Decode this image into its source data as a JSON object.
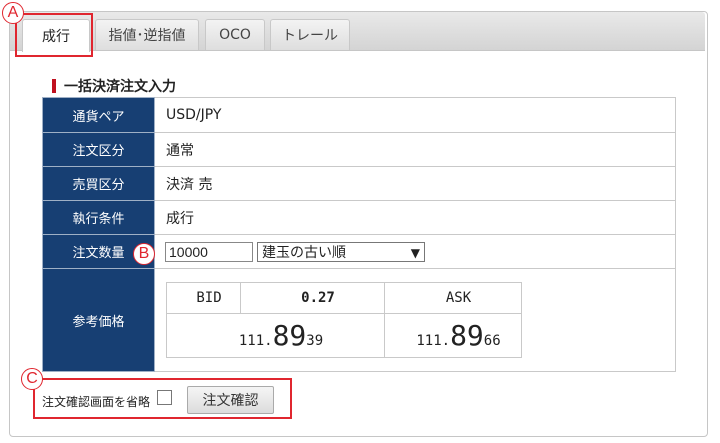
{
  "tabs": [
    {
      "label": "成行"
    },
    {
      "label": "指値･逆指値"
    },
    {
      "label": "OCO"
    },
    {
      "label": "トレール"
    }
  ],
  "section_title": "一括決済注文入力",
  "form": {
    "currency_pair": {
      "label": "通貨ペア",
      "value": "USD/JPY"
    },
    "order_type": {
      "label": "注文区分",
      "value": "通常"
    },
    "trade_type": {
      "label": "売買区分",
      "value": "決済 売"
    },
    "execution": {
      "label": "執行条件",
      "value": "成行"
    },
    "quantity": {
      "label": "注文数量",
      "value": "10000",
      "select_value": "建玉の古い順"
    },
    "reference_price": {
      "label": "参考価格"
    }
  },
  "price": {
    "bid_label": "BID",
    "spread": "0.27",
    "ask_label": "ASK",
    "bid": {
      "prefix": "111.",
      "big": "89",
      "small": "39"
    },
    "ask": {
      "prefix": "111.",
      "big": "89",
      "small": "66"
    },
    "bid_color": "#2222cc",
    "ask_color": "#d42222"
  },
  "skip_confirm": {
    "label": "注文確認画面を省略",
    "checked": false
  },
  "confirm_button": "注文確認",
  "annotations": {
    "a": "A",
    "b": "B",
    "c": "C",
    "color": "#e0262f"
  },
  "icons": {
    "select": "chevron-down-icon"
  }
}
